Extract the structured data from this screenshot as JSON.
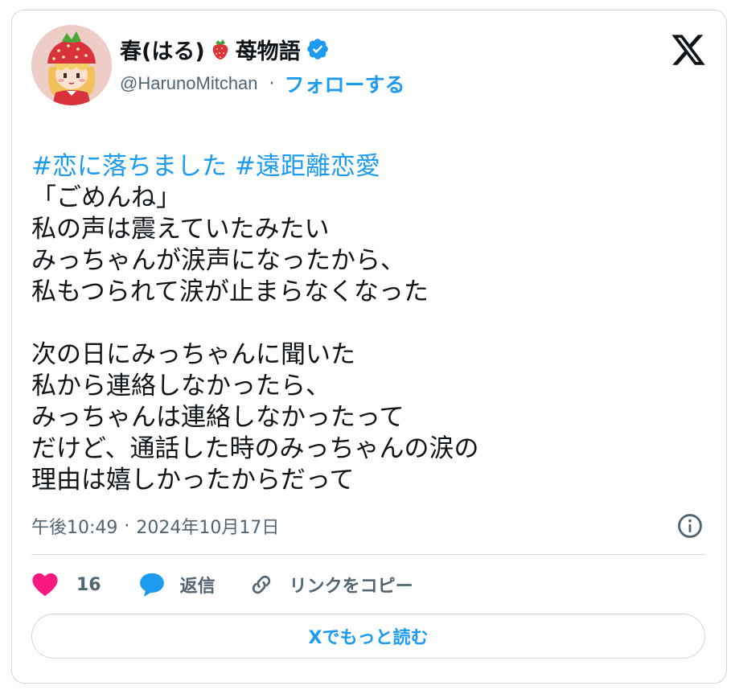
{
  "author": {
    "display_name": "春(はる)",
    "name_suffix": "苺物語",
    "handle": "@HarunoMitchan",
    "follow_label": "フォローする",
    "verified": true,
    "avatar_icon": "strawberry-girl-avatar"
  },
  "tweet": {
    "hashtags": [
      "#恋に落ちました",
      "#遠距離恋愛"
    ],
    "body": "「ごめんね」\n私の声は震えていたみたい\nみっちゃんが涙声になったから、\n私もつられて涙が止まらなくなった\n\n次の日にみっちゃんに聞いた\n私から連絡しなかったら、\nみっちゃんは連絡しなかったって\nだけど、通話した時のみっちゃんの涙の\n理由は嬉しかったからだって",
    "time": "午後10:49",
    "date": "2024年10月17日"
  },
  "actions": {
    "like_count": "16",
    "reply_label": "返信",
    "copy_link_label": "リンクをコピー",
    "read_more_label": "Xでもっと読む"
  },
  "colors": {
    "accent": "#1d9bf0",
    "like": "#f91880",
    "text": "#0f1419",
    "muted": "#536471",
    "border": "#cfd9de"
  }
}
